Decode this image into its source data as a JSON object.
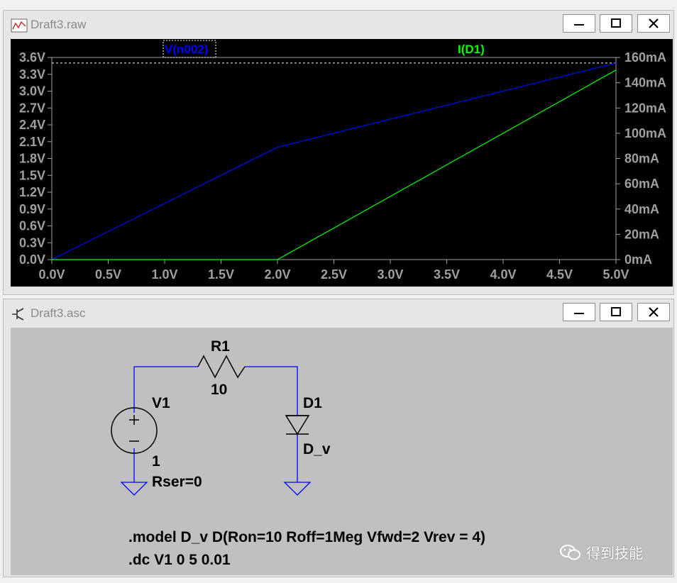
{
  "plot_window": {
    "title": "Draft3.raw",
    "trace_labels": [
      "V(n002)",
      "I(D1)"
    ]
  },
  "schematic_window": {
    "title": "Draft3.asc",
    "components": {
      "r1_name": "R1",
      "r1_value": "10",
      "v1_name": "V1",
      "v1_value": "1",
      "v1_rser": "Rser=0",
      "d1_name": "D1",
      "d1_model": "D_v"
    },
    "directives": [
      ".model D_v D(Ron=10 Roff=1Meg Vfwd=2 Vrev = 4)",
      ".dc V1 0 5 0.01"
    ]
  },
  "watermark": "得到技能",
  "colors": {
    "voltage_trace": "#0000ff",
    "current_trace": "#00ff00",
    "plot_bg": "#000000",
    "schematic_bg": "#c0c0c0",
    "wire": "#0000ff"
  },
  "chart_data": {
    "type": "line",
    "xlabel": "",
    "ylabel": "",
    "x_ticks": [
      "0.0V",
      "0.5V",
      "1.0V",
      "1.5V",
      "2.0V",
      "2.5V",
      "3.0V",
      "3.5V",
      "4.0V",
      "4.5V",
      "5.0V"
    ],
    "y_left_ticks": [
      "0.0V",
      "0.3V",
      "0.6V",
      "0.9V",
      "1.2V",
      "1.5V",
      "1.8V",
      "2.1V",
      "2.4V",
      "2.7V",
      "3.0V",
      "3.3V",
      "3.6V"
    ],
    "y_right_ticks": [
      "0mA",
      "20mA",
      "40mA",
      "60mA",
      "80mA",
      "100mA",
      "120mA",
      "140mA",
      "160mA"
    ],
    "xlim": [
      0,
      5
    ],
    "ylim_left": [
      0,
      3.6
    ],
    "ylim_right": [
      0,
      160
    ],
    "series": [
      {
        "name": "V(n002)",
        "axis": "left",
        "color": "#0000ff",
        "x": [
          0,
          2,
          5
        ],
        "y": [
          0,
          2,
          3.5
        ]
      },
      {
        "name": "I(D1)",
        "axis": "right",
        "color": "#00ff00",
        "x": [
          0,
          2,
          5
        ],
        "y": [
          0,
          0,
          150
        ]
      }
    ],
    "cursor_line_left": 3.5
  }
}
